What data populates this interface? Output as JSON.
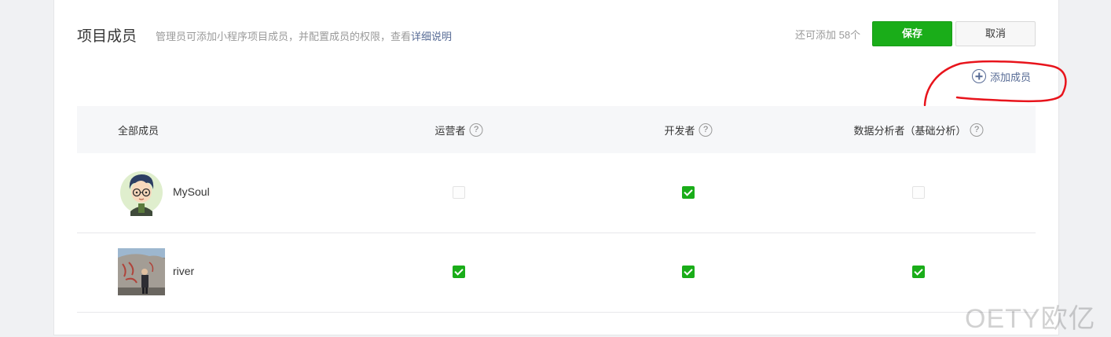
{
  "header": {
    "title": "项目成员",
    "description": "管理员可添加小程序项目成员，并配置成员的权限，查看",
    "description_link": "详细说明",
    "quota_text": "还可添加 58个",
    "save_label": "保存",
    "cancel_label": "取消"
  },
  "add_member_label": "添加成员",
  "table": {
    "columns": [
      "全部成员",
      "运营者",
      "开发者",
      "数据分析者（基础分析）"
    ],
    "help_glyph": "?",
    "rows": [
      {
        "name": "MySoul",
        "avatar": "cartoon-boy-avatar",
        "operator": false,
        "developer": true,
        "analyst": false
      },
      {
        "name": "river",
        "avatar": "photo-avatar",
        "operator": true,
        "developer": true,
        "analyst": true
      }
    ]
  },
  "watermark": "OETY欧亿",
  "colors": {
    "accent_green": "#1aad19",
    "link_blue": "#576b95",
    "annotation_red": "#e8141c"
  }
}
